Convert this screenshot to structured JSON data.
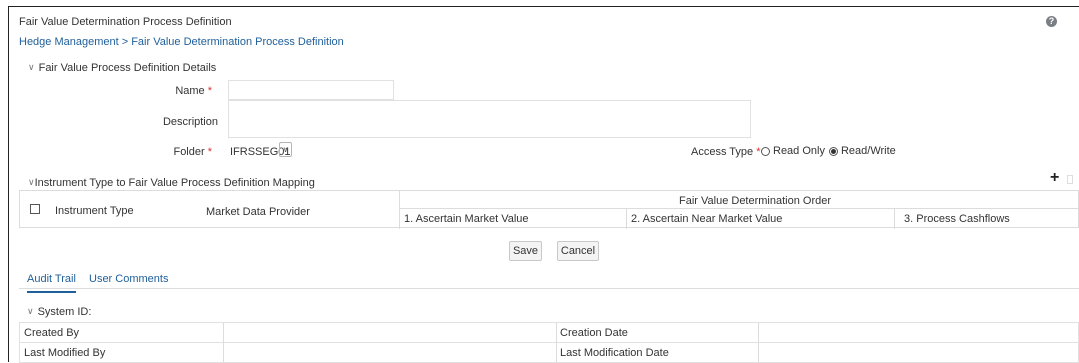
{
  "header": {
    "title": "Fair Value Determination Process Definition",
    "breadcrumb": "Hedge Management > Fair Value Determination Process Definition",
    "help_icon": "question-icon"
  },
  "details": {
    "section_label": "Fair Value Process Definition Details",
    "name_label": "Name",
    "name_value": "",
    "description_label": "Description",
    "description_value": "",
    "folder_label": "Folder",
    "folder_value": "IFRSSEG01",
    "access_type_label": "Access Type",
    "access_options": [
      "Read Only",
      "Read/Write"
    ],
    "access_selected": "Read/Write",
    "required_marker": "*"
  },
  "mapping": {
    "section_label": "Instrument Type to Fair Value Process Definition Mapping",
    "add_icon": "+",
    "columns": {
      "instrument_type": "Instrument Type",
      "market_data_provider": "Market Data Provider",
      "group": "Fair Value Determination Order",
      "sub": [
        "1. Ascertain Market Value",
        "2. Ascertain Near Market Value",
        "3. Process Cashflows"
      ]
    }
  },
  "actions": {
    "save": "Save",
    "cancel": "Cancel"
  },
  "tabs": {
    "items": [
      "Audit Trail",
      "User Comments"
    ],
    "active": "Audit Trail"
  },
  "audit": {
    "system_id_label": "System ID:",
    "created_by_label": "Created By",
    "created_by_value": "",
    "creation_date_label": "Creation Date",
    "creation_date_value": "",
    "last_modified_by_label": "Last Modified By",
    "last_modified_by_value": "",
    "last_modification_date_label": "Last Modification Date",
    "last_modification_date_value": ""
  }
}
